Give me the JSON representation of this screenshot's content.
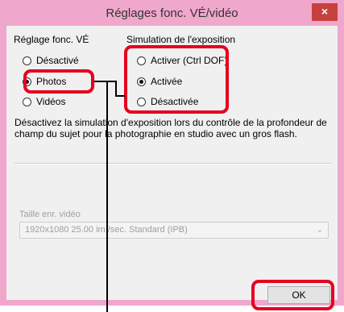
{
  "window": {
    "title": "Réglages fonc. VÉ/vidéo",
    "close_label": "×"
  },
  "left_group": {
    "label": "Réglage fonc. VÉ",
    "options": [
      {
        "label": "Désactivé",
        "selected": false
      },
      {
        "label": "Photos",
        "selected": true
      },
      {
        "label": "Vidéos",
        "selected": false
      }
    ]
  },
  "right_group": {
    "label": "Simulation de l'exposition",
    "options": [
      {
        "label": "Activer (Ctrl DOF)",
        "selected": false
      },
      {
        "label": "Activée",
        "selected": true
      },
      {
        "label": "Désactivée",
        "selected": false
      }
    ]
  },
  "description": "Désactivez la simulation d'exposition lors du contrôle de la profondeur de champ du sujet pour la photographie en studio avec un gros flash.",
  "video": {
    "label": "Taille enr. vidéo",
    "selected_value": "1920x1080 25.00 im./sec. Standard (IPB)",
    "dropdown_icon": "chevron-down-icon"
  },
  "ok_label": "OK",
  "colors": {
    "titlebar": "#f0a7cc",
    "close_button": "#c7413c",
    "highlight": "#e5001f"
  }
}
